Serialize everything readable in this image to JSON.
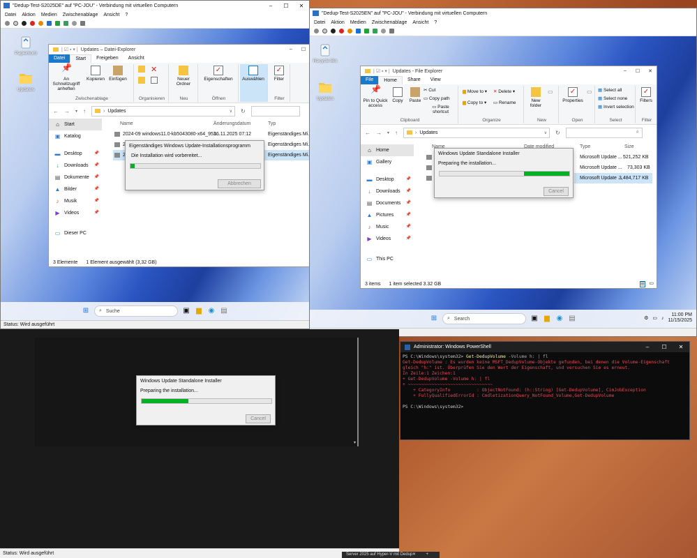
{
  "vm_de": {
    "title": "\"Dedup-Test-S2025DE\" auf \"PC-JOU\" - Verbindung mit virtuellen Computern",
    "menu": [
      "Datei",
      "Aktion",
      "Medien",
      "Zwischenablage",
      "Ansicht",
      "?"
    ],
    "status": "Status: Wird ausgeführt"
  },
  "vm_en": {
    "title": "\"Dedup-Test-S2025EN\" auf \"PC-JOU\" - Verbindung mit virtuellen Computern",
    "menu": [
      "Datei",
      "Aktion",
      "Medien",
      "Zwischenablage",
      "Ansicht",
      "?"
    ],
    "status": "Status: Wird ausgeführt"
  },
  "vm_bottom": {
    "status": "Status: Wird ausgeführt"
  },
  "desktop_de": {
    "icons": [
      "Papierkorb",
      "Updates"
    ],
    "search": "Suche"
  },
  "desktop_en": {
    "icons": [
      "Recycle Bin",
      "Updates"
    ],
    "search": "Search",
    "time": "11:00 PM",
    "date": "11/15/2025"
  },
  "fe_de": {
    "title": "Updates – Datei-Explorer",
    "tabs": [
      "Datei",
      "Start",
      "Freigeben",
      "Ansicht"
    ],
    "ribbon": {
      "pin": "An Schnellzugriff anheften",
      "copy": "Kopieren",
      "paste": "Einfügen",
      "grp_clip": "Zwischenablage",
      "grp_org": "Organisieren",
      "newfolder": "Neuer Ordner",
      "grp_new": "Neu",
      "props": "Eigenschaften",
      "grp_open": "Öffnen",
      "select": "Auswählen",
      "filter": "Filter",
      "grp_filter": "Filter"
    },
    "path": "Updates",
    "nav": [
      "Start",
      "Katalog",
      "Desktop",
      "Downloads",
      "Dokumente",
      "Bilder",
      "Musik",
      "Videos",
      "Dieser PC"
    ],
    "columns": [
      "Name",
      "Änderungsdatum",
      "Typ"
    ],
    "rows": [
      {
        "name": "2024-09 windows11.0-kb5043080-x64_953...",
        "date": "16.11.2025 07:12",
        "type": "Eigenständiges Mi..."
      },
      {
        "name": "2",
        "date": "",
        "type": "Eigenständiges Mi..."
      },
      {
        "name": "2",
        "date": "",
        "type": "Eigenständiges Mi..."
      }
    ],
    "status_items": "3 Elemente",
    "status_sel": "1 Element ausgewählt (3,32 GB)"
  },
  "dlg_de": {
    "title": "Eigenständiges Windows Update-Installationsprogramm",
    "text": "Die Installation wird vorbereitet...",
    "button": "Abbrechen",
    "progress": 0.03
  },
  "fe_en": {
    "title": "Updates - File Explorer",
    "tabs": [
      "File",
      "Home",
      "Share",
      "View"
    ],
    "ribbon": {
      "pin": "Pin to Quick access",
      "copy": "Copy",
      "paste": "Paste",
      "cut": "Cut",
      "copypath": "Copy path",
      "pasteshortcut": "Paste shortcut",
      "grp_clip": "Clipboard",
      "moveto": "Move to",
      "copyto": "Copy to",
      "delete": "Delete",
      "rename": "Rename",
      "grp_org": "Organize",
      "newfolder": "New folder",
      "grp_new": "New",
      "props": "Properties",
      "grp_open": "Open",
      "selall": "Select all",
      "selnone": "Select none",
      "invsel": "Invert selection",
      "grp_select": "Select",
      "filter": "Filters",
      "grp_filter": "Filter"
    },
    "path": "Updates",
    "nav": [
      "Home",
      "Gallery",
      "Desktop",
      "Downloads",
      "Documents",
      "Pictures",
      "Music",
      "Videos",
      "This PC"
    ],
    "columns": [
      "Name",
      "Date modified",
      "Type",
      "Size"
    ],
    "rows": [
      {
        "type": "Microsoft Update ...",
        "size": "521,252 KB"
      },
      {
        "type": "Microsoft Update ...",
        "size": "73,303 KB"
      },
      {
        "type": "Microsoft Update ...",
        "size": "3,484,717 KB"
      }
    ],
    "status_items": "3 items",
    "status_sel": "1 item selected  3.32 GB"
  },
  "dlg_en": {
    "title": "Windows Update Standalone Installer",
    "text": "Preparing the installation...",
    "button": "Cancel",
    "progress": 0.35
  },
  "dlg_bottom": {
    "title": "Windows Update Standalone Installer",
    "text": "Preparing the installation...",
    "button": "Cancel",
    "progress": 0.36
  },
  "powershell": {
    "title": "Administrator: Windows PowerShell",
    "l1": "PS C:\\Windows\\system32> ",
    "cmd": "Get-DedupVolume",
    "arg": " -Volume h: | fl",
    "e1": "Get-DedupVolume : Es wurden keine MSFT_DedupVolume-Objekte gefunden, bei denen die Volume-Eigenschaft",
    "e2": "gleich \"h:\" ist. Überprüfen Sie den Wert der Eigenschaft, und versuchen Sie es erneut.",
    "e3": "In Zeile:1 Zeichen:1",
    "e4": "+ Get-DedupVolume -Volume h: | fl",
    "e5": "+ ~~~~~~~~~~~~~~~~~~~~~~~~~~~~~~~~",
    "e6": "    + CategoryInfo          : ObjectNotFound: (h::String) [Get-DedupVolume], CimJobException",
    "e7": "    + FullyQualifiedErrorId : CmdletizationQuery_NotFound_Volume,Get-DedupVolume",
    "l2": "PS C:\\Windows\\system32>"
  },
  "bottom_taskbar_text": "Server 2025 auf Hyper-V mit Dedup"
}
